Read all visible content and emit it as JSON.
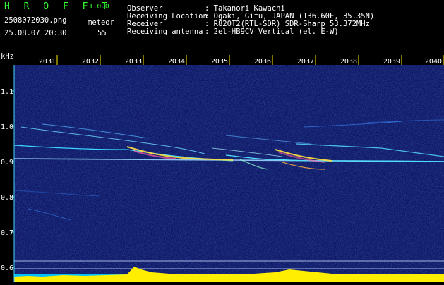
{
  "app": {
    "name": "H R O F F T",
    "version": "1.0.0"
  },
  "file": {
    "name": "2508072030.png",
    "datetime": "25.08.07 20:30"
  },
  "meteor": {
    "label": "meteor",
    "count": "55"
  },
  "info": {
    "rows": [
      {
        "key": "Observer",
        "value": ": Takanori Kawachi"
      },
      {
        "key": "Receiving Location",
        "value": ": Ogaki, Gifu, JAPAN (136.60E, 35.35N)"
      },
      {
        "key": "Receiver",
        "value": ": R820T2(RTL-SDR) SDR-Sharp 53.372MHz"
      },
      {
        "key": "Receiving antenna",
        "value": ": 2el-HB9CV Vertical (el. E-W)"
      }
    ]
  },
  "axes": {
    "unit": "kHz",
    "x_ticks": [
      "2031",
      "2032",
      "2033",
      "2034",
      "2035",
      "2036",
      "2037",
      "2038",
      "2039",
      "2040"
    ],
    "y_ticks": [
      "1.1",
      "1.0",
      "0.9",
      "0.8",
      "0.7",
      "0.6"
    ]
  },
  "colors": {
    "background": "#000000",
    "spectrum_bg": "#101a6a",
    "text": "#ffffff",
    "accent_green": "#30ff30",
    "tick_yellow": "#ffea00",
    "axis_cyan": "#3fd8ff"
  }
}
